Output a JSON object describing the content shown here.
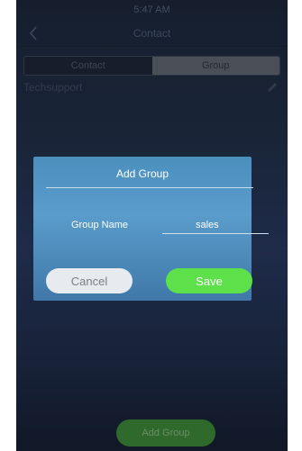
{
  "status_bar": {
    "time": "5:47 AM"
  },
  "header": {
    "title": "Contact"
  },
  "tabs": [
    {
      "label": "Contact",
      "selected": false
    },
    {
      "label": "Group",
      "selected": true
    }
  ],
  "groups": [
    {
      "name": "Techsupport"
    }
  ],
  "dialog": {
    "title": "Add Group",
    "field_label": "Group Name",
    "field_value": "sales",
    "cancel_label": "Cancel",
    "save_label": "Save"
  },
  "footer": {
    "add_group_label": "Add Group"
  },
  "colors": {
    "dialog_blue": "#4b8fbd",
    "save_green": "#5ee04a",
    "cancel_gray": "#e7eaee",
    "add_group_green": "#2f6a2c"
  },
  "icons": {
    "back": "chevron-left-icon",
    "edit": "pencil-icon"
  }
}
